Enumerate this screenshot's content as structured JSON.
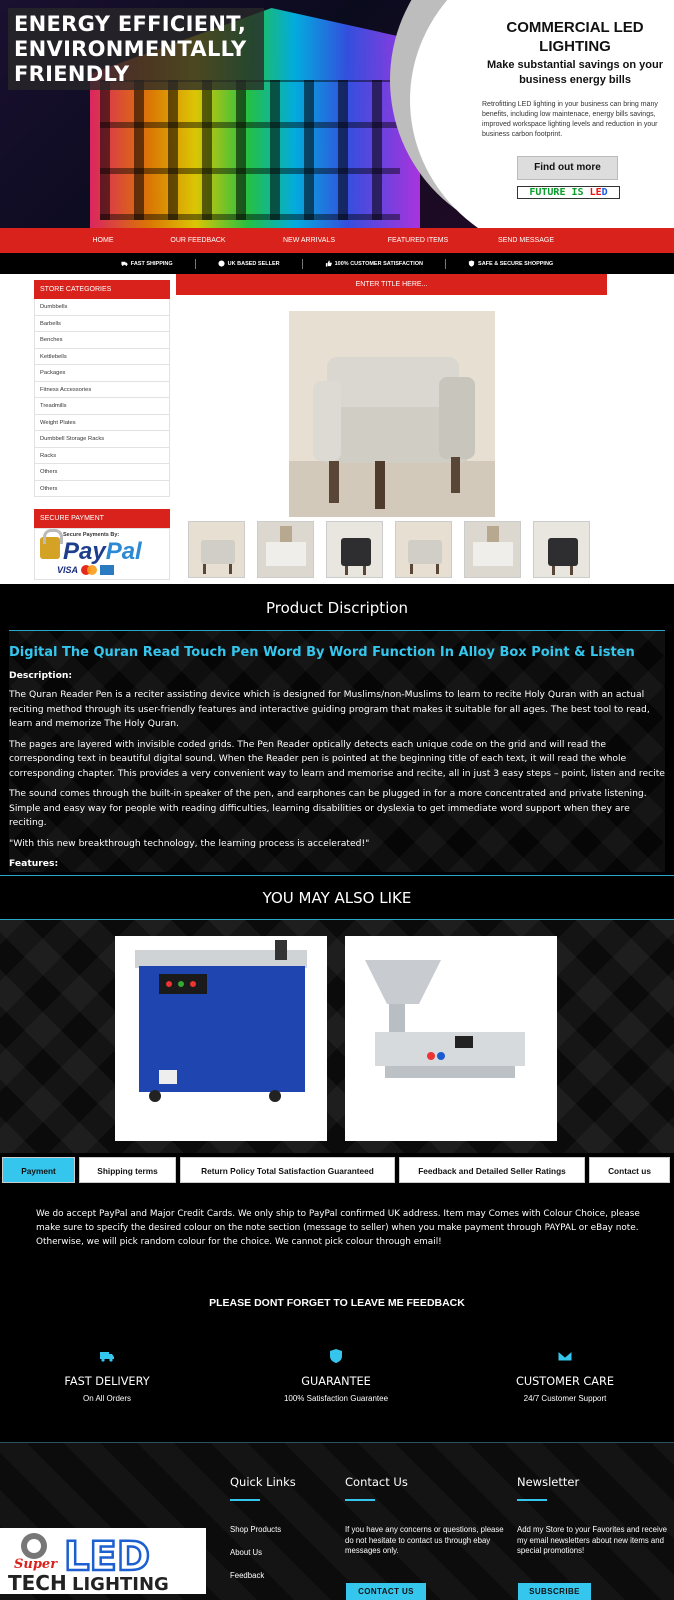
{
  "hero": {
    "headline": "ENERGY EFFICIENT, ENVIRONMENTALLY FRIENDLY",
    "commercial_title": "COMMERCIAL LED LIGHTING",
    "subtitle": "Make substantial savings on your business energy bills",
    "paragraph": "Retrofitting LED lighting in your business can bring many benefits, including low maintenace, energy bills savings, improved workspace lighting levels and reduction in your business carbon footprint.",
    "cta": "Find out more",
    "tagline_a": "FUTURE IS ",
    "tagline_b": "LE",
    "tagline_c": "D"
  },
  "nav": {
    "items": [
      "HOME",
      "OUR FEEDBACK",
      "NEW ARRIVALS",
      "FEATURED ITEMS",
      "SEND MESSAGE"
    ]
  },
  "strip": {
    "items": [
      "FAST SHIPPING",
      "UK BASED SELLER",
      "100% CUSTOMER SATISFACTION",
      "SAFE & SECURE SHOPPING"
    ]
  },
  "sidebar": {
    "categories_title": "STORE CATEGORIES",
    "categories": [
      "Dumbbells",
      "Barbells",
      "Benches",
      "Kettlebells",
      "Packages",
      "Fitness Accessories",
      "Treadmills",
      "Weight Plates",
      "Dumbbell Storage Racks",
      "Racks",
      "Others",
      "Others"
    ],
    "payment_title": "SECURE PAYMENT",
    "secure_label": "Secure Payments By:",
    "paypal_a": "Pay",
    "paypal_b": "Pal",
    "visa": "VISA"
  },
  "listing": {
    "title_bar": "ENTER TITLE HERE...",
    "thumb_count": 6
  },
  "description": {
    "header": "Product Discription",
    "title": "Digital The Quran Read Touch Pen Word By Word Function In Alloy Box Point & Listen",
    "desc_label": "Description:",
    "paragraphs": [
      "The Quran Reader Pen is a reciter assisting device which is designed for Muslims/non-Muslims to learn to recite Holy Quran with an actual reciting method through its user-friendly features and interactive guiding program that makes it suitable for all ages. The best tool to read, learn and memorize The Holy Quran.",
      "The pages are layered with invisible coded grids. The Pen Reader optically detects each unique code on the grid and will read the corresponding text in beautiful digital sound. When the Reader pen is pointed at the beginning title of each text, it will read the whole corresponding chapter. This provides a very convenient way to learn and memorise and recite, all in just 3 easy steps – point, listen and recite.",
      "The sound comes through the built-in speaker of the pen, and earphones can be plugged in for a more concentrated and private listening. Simple and easy way for people with reading difficulties, learning disabilities or dyslexia to get immediate word support when they are reciting.",
      "\"With this new breakthrough technology, the learning process is accelerated!\""
    ],
    "features_label": "Features:"
  },
  "may_like": {
    "header": "YOU MAY ALSO LIKE"
  },
  "tabs": {
    "items": [
      "Payment",
      "Shipping terms",
      "Return Policy Total Satisfaction Guaranteed",
      "Feedback and Detailed Seller Ratings",
      "Contact us"
    ],
    "active": "Payment",
    "content": "We do accept PayPal and Major Credit Cards. We only ship to PayPal confirmed UK address. Item may Comes with Colour Choice, please make sure to specify the desired colour on the note section (message to seller) when you make payment through PAYPAL or eBay note. Otherwise, we will pick random colour for the choice. We cannot pick colour through email!"
  },
  "feedback_note": "PLEASE DONT FORGET TO LEAVE ME FEEDBACK",
  "features": [
    {
      "title": "FAST DELIVERY",
      "subtitle": "On All Orders",
      "icon": "truck-icon"
    },
    {
      "title": "GUARANTEE",
      "subtitle": "100% Satisfaction Guarantee",
      "icon": "shield-icon"
    },
    {
      "title": "CUSTOMER CARE",
      "subtitle": "24/7 Customer Support",
      "icon": "envelope-icon"
    }
  ],
  "footer": {
    "quick_links_title": "Quick Links",
    "quick_links": [
      "Shop Products",
      "About Us",
      "Feedback"
    ],
    "contact_title": "Contact Us",
    "contact_text": "If you have any concerns or questions, please do not hesitate to contact us through ebay messages only.",
    "contact_button": "CONTACT US",
    "newsletter_title": "Newsletter",
    "newsletter_text": "Add my Store to your Favorites and receive my email newsletters about new items and special promotions!",
    "subscribe_button": "SUBSCRIBE",
    "logo_super": "Super",
    "logo_led": "LED",
    "logo_tech": "TECH",
    "logo_lighting": "LIGHTING"
  },
  "colors": {
    "red": "#d8221b",
    "accent": "#35c6ee",
    "dark": "#000000"
  }
}
